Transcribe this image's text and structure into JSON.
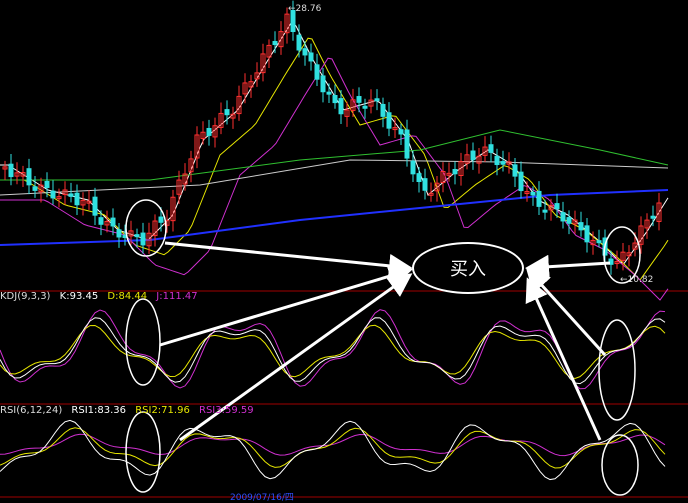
{
  "price_marks": {
    "high": "28.76",
    "low": "10.82"
  },
  "annotation": {
    "text": "买入"
  },
  "kdj": {
    "title": "KDJ(9,3,3)",
    "k": "K:93.45",
    "d": "D:84.44",
    "j": "J:111.47",
    "colors": {
      "k": "#ffffff",
      "d": "#e6e600",
      "j": "#d030d0"
    }
  },
  "rsi": {
    "title": "RSI(6,12,24)",
    "rsi1": "RSI1:83.36",
    "rsi2": "RSI2:71.96",
    "rsi3": "RSI3:59.59",
    "colors": {
      "rsi1": "#ffffff",
      "rsi2": "#e6e600",
      "rsi3": "#d030d0"
    }
  },
  "date_label": "2009/07/16/四",
  "colors": {
    "up": "#ff3030",
    "down": "#30e0e0",
    "divider": "#a00000",
    "ma_long": "#2030ff"
  }
}
